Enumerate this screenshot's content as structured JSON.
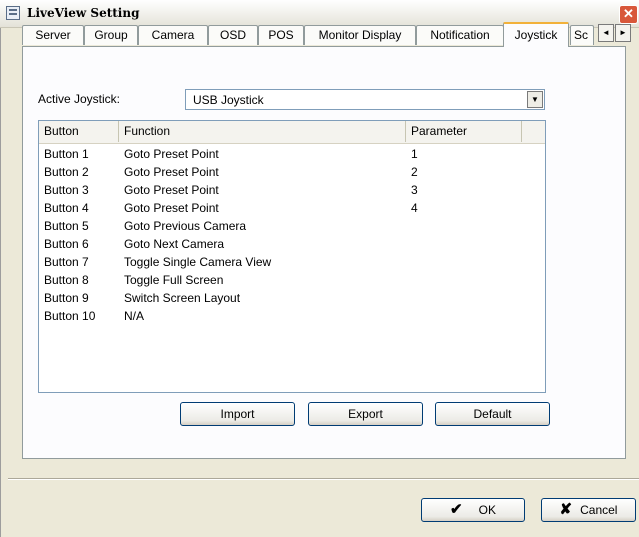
{
  "window": {
    "title": "LiveView Setting",
    "close_symbol": "✕"
  },
  "tabs": [
    {
      "label": "Server"
    },
    {
      "label": "Group"
    },
    {
      "label": "Camera"
    },
    {
      "label": "OSD"
    },
    {
      "label": "POS"
    },
    {
      "label": "Monitor Display"
    },
    {
      "label": "Notification"
    },
    {
      "label": "Joystick",
      "active": true
    },
    {
      "label": "Sc"
    }
  ],
  "tab_scroll": {
    "left": "◄",
    "right": "►"
  },
  "joystick": {
    "active_label": "Active Joystick:",
    "active_value": "USB Joystick",
    "dropdown_arrow": "▼"
  },
  "table": {
    "columns": [
      "Button",
      "Function",
      "Parameter"
    ],
    "rows": [
      {
        "button": "Button 1",
        "function": "Goto Preset Point",
        "parameter": "1"
      },
      {
        "button": "Button 2",
        "function": "Goto Preset Point",
        "parameter": "2"
      },
      {
        "button": "Button 3",
        "function": "Goto Preset Point",
        "parameter": "3"
      },
      {
        "button": "Button 4",
        "function": "Goto Preset Point",
        "parameter": "4"
      },
      {
        "button": "Button 5",
        "function": "Goto Previous Camera",
        "parameter": ""
      },
      {
        "button": "Button 6",
        "function": "Goto Next Camera",
        "parameter": ""
      },
      {
        "button": "Button 7",
        "function": "Toggle Single Camera View",
        "parameter": ""
      },
      {
        "button": "Button 8",
        "function": "Toggle Full Screen",
        "parameter": ""
      },
      {
        "button": "Button 9",
        "function": "Switch Screen Layout",
        "parameter": ""
      },
      {
        "button": "Button 10",
        "function": "N/A",
        "parameter": ""
      }
    ]
  },
  "actions": {
    "import": "Import",
    "export": "Export",
    "default": "Default"
  },
  "dialog": {
    "ok": "OK",
    "cancel": "Cancel",
    "ok_icon": "✔",
    "cancel_icon": "✘"
  },
  "icons": {
    "app": "app-icon",
    "close": "close-icon",
    "dropdown": "chevron-down-icon",
    "ok": "checkmark-icon",
    "cancel": "x-icon"
  },
  "colors": {
    "active_tab_accent": "#f2b13a",
    "close_button": "#d8573a"
  }
}
